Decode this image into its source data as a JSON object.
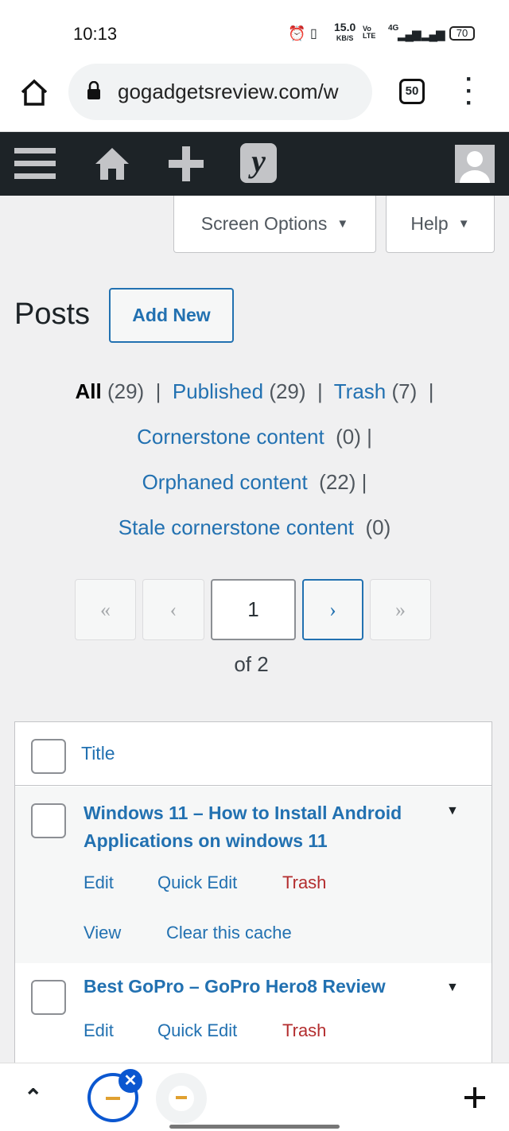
{
  "status_bar": {
    "time": "10:13",
    "net_speed": "15.0",
    "net_unit": "KB/S",
    "volte": "Vo LTE",
    "network": "4G",
    "battery": "70"
  },
  "browser": {
    "url": "gogadgetsreview.com/w",
    "tab_count": "50",
    "icons": [
      "home-icon",
      "lock-icon",
      "more-vert-icon"
    ]
  },
  "admin_bar": {
    "icons": [
      "menu-icon",
      "home-icon",
      "plus-icon",
      "yoast-icon",
      "avatar-icon"
    ]
  },
  "screen_options": "Screen Options",
  "help": "Help",
  "page_title": "Posts",
  "add_new": "Add New",
  "filters": {
    "all": "All",
    "all_count": "(29)",
    "published": "Published",
    "published_count": "(29)",
    "trash": "Trash",
    "trash_count": "(7)",
    "cornerstone": "Cornerstone content",
    "cornerstone_count": "(0)",
    "orphaned": "Orphaned content",
    "orphaned_count": "(22)",
    "stale": "Stale cornerstone content",
    "stale_count": "(0)",
    "sep": "|"
  },
  "pagination": {
    "first": "«",
    "prev": "‹",
    "current": "1",
    "next": "›",
    "last": "»",
    "of": "of 2"
  },
  "table": {
    "header": "Title",
    "rows": [
      {
        "title": "Windows 11 – How to Install Android Applications on windows 11",
        "actions": [
          "Edit",
          "Quick Edit",
          "Trash",
          "View",
          "Clear this cache"
        ]
      },
      {
        "title": "Best GoPro – GoPro Hero8 Review",
        "actions": [
          "Edit",
          "Quick Edit",
          "Trash"
        ]
      }
    ]
  },
  "colors": {
    "accent": "#2271b1",
    "trash": "#b32d2e",
    "admin_bar": "#1d2327"
  }
}
